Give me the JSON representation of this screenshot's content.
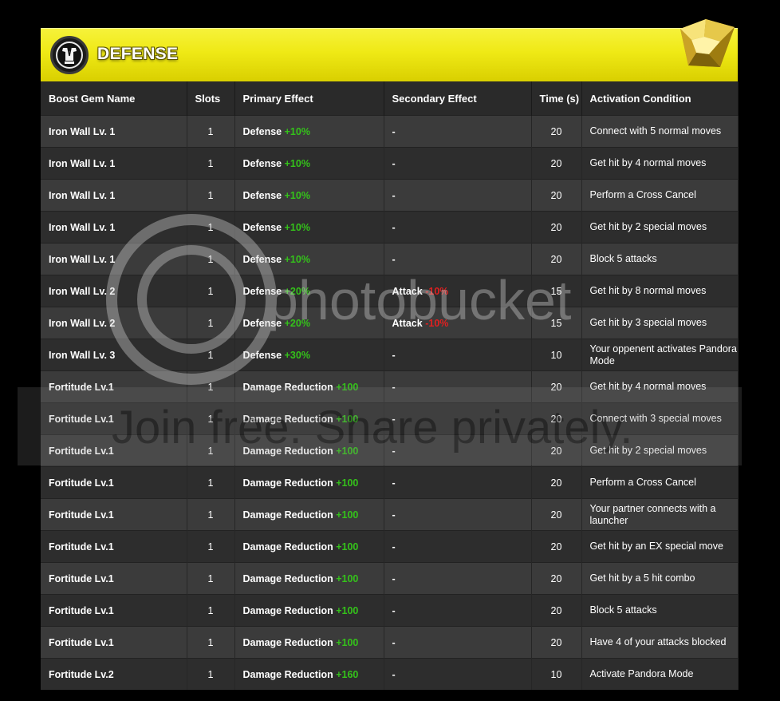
{
  "banner": {
    "title": "DEFENSE"
  },
  "headers": [
    "Boost Gem Name",
    "Slots",
    "Primary Effect",
    "Secondary Effect",
    "Time (s)",
    "Activation Condition"
  ],
  "rows": [
    {
      "name": "Iron Wall Lv. 1",
      "slots": "1",
      "primary": "Defense",
      "primary_bonus": "+10%",
      "secondary": "-",
      "secondary_bonus": "",
      "time": "20",
      "condition": "Connect with 5 normal moves"
    },
    {
      "name": "Iron Wall Lv. 1",
      "slots": "1",
      "primary": "Defense",
      "primary_bonus": "+10%",
      "secondary": "-",
      "secondary_bonus": "",
      "time": "20",
      "condition": "Get hit by 4 normal moves"
    },
    {
      "name": "Iron Wall Lv. 1",
      "slots": "1",
      "primary": "Defense",
      "primary_bonus": "+10%",
      "secondary": "-",
      "secondary_bonus": "",
      "time": "20",
      "condition": "Perform a Cross Cancel"
    },
    {
      "name": "Iron Wall Lv. 1",
      "slots": "1",
      "primary": "Defense",
      "primary_bonus": "+10%",
      "secondary": "-",
      "secondary_bonus": "",
      "time": "20",
      "condition": "Get hit by 2 special moves"
    },
    {
      "name": "Iron Wall Lv. 1",
      "slots": "1",
      "primary": "Defense",
      "primary_bonus": "+10%",
      "secondary": "-",
      "secondary_bonus": "",
      "time": "20",
      "condition": "Block 5 attacks"
    },
    {
      "name": "Iron Wall Lv. 2",
      "slots": "1",
      "primary": "Defense",
      "primary_bonus": "+20%",
      "secondary": "Attack",
      "secondary_bonus": "-10%",
      "time": "15",
      "condition": "Get hit by 8 normal moves"
    },
    {
      "name": "Iron Wall Lv. 2",
      "slots": "1",
      "primary": "Defense",
      "primary_bonus": "+20%",
      "secondary": "Attack",
      "secondary_bonus": "-10%",
      "time": "15",
      "condition": "Get hit by 3 special moves"
    },
    {
      "name": "Iron Wall Lv. 3",
      "slots": "1",
      "primary": "Defense",
      "primary_bonus": "+30%",
      "secondary": "-",
      "secondary_bonus": "",
      "time": "10",
      "condition": "Your oppenent activates Pandora Mode"
    },
    {
      "name": "Fortitude Lv.1",
      "slots": "1",
      "primary": "Damage Reduction",
      "primary_bonus": "+100",
      "secondary": "-",
      "secondary_bonus": "",
      "time": "20",
      "condition": "Get hit by 4 normal moves"
    },
    {
      "name": "Fortitude Lv.1",
      "slots": "1",
      "primary": "Damage Reduction",
      "primary_bonus": "+100",
      "secondary": "-",
      "secondary_bonus": "",
      "time": "20",
      "condition": "Connect with 3 special moves"
    },
    {
      "name": "Fortitude Lv.1",
      "slots": "1",
      "primary": "Damage Reduction",
      "primary_bonus": "+100",
      "secondary": "-",
      "secondary_bonus": "",
      "time": "20",
      "condition": "Get hit by 2 special moves"
    },
    {
      "name": "Fortitude Lv.1",
      "slots": "1",
      "primary": "Damage Reduction",
      "primary_bonus": "+100",
      "secondary": "-",
      "secondary_bonus": "",
      "time": "20",
      "condition": "Perform a Cross Cancel"
    },
    {
      "name": "Fortitude Lv.1",
      "slots": "1",
      "primary": "Damage Reduction",
      "primary_bonus": "+100",
      "secondary": "-",
      "secondary_bonus": "",
      "time": "20",
      "condition": "Your partner connects with a launcher"
    },
    {
      "name": "Fortitude Lv.1",
      "slots": "1",
      "primary": "Damage Reduction",
      "primary_bonus": "+100",
      "secondary": "-",
      "secondary_bonus": "",
      "time": "20",
      "condition": "Get hit by an EX special move"
    },
    {
      "name": "Fortitude Lv.1",
      "slots": "1",
      "primary": "Damage Reduction",
      "primary_bonus": "+100",
      "secondary": "-",
      "secondary_bonus": "",
      "time": "20",
      "condition": "Get hit by a 5 hit combo"
    },
    {
      "name": "Fortitude Lv.1",
      "slots": "1",
      "primary": "Damage Reduction",
      "primary_bonus": "+100",
      "secondary": "-",
      "secondary_bonus": "",
      "time": "20",
      "condition": "Block 5 attacks"
    },
    {
      "name": "Fortitude Lv.1",
      "slots": "1",
      "primary": "Damage Reduction",
      "primary_bonus": "+100",
      "secondary": "-",
      "secondary_bonus": "",
      "time": "20",
      "condition": "Have 4 of your attacks blocked"
    },
    {
      "name": "Fortitude Lv.2",
      "slots": "1",
      "primary": "Damage Reduction",
      "primary_bonus": "+160",
      "secondary": "-",
      "secondary_bonus": "",
      "time": "10",
      "condition": "Activate Pandora Mode"
    }
  ],
  "watermark": {
    "logo_text": "photobucket",
    "tagline": "Join free. Share privately."
  },
  "colors": {
    "banner": "#efe915",
    "positive": "#34c21a",
    "negative": "#e02020"
  },
  "icons": {
    "emblem": "gi-emblem-icon",
    "gem": "yellow-gem-icon"
  }
}
